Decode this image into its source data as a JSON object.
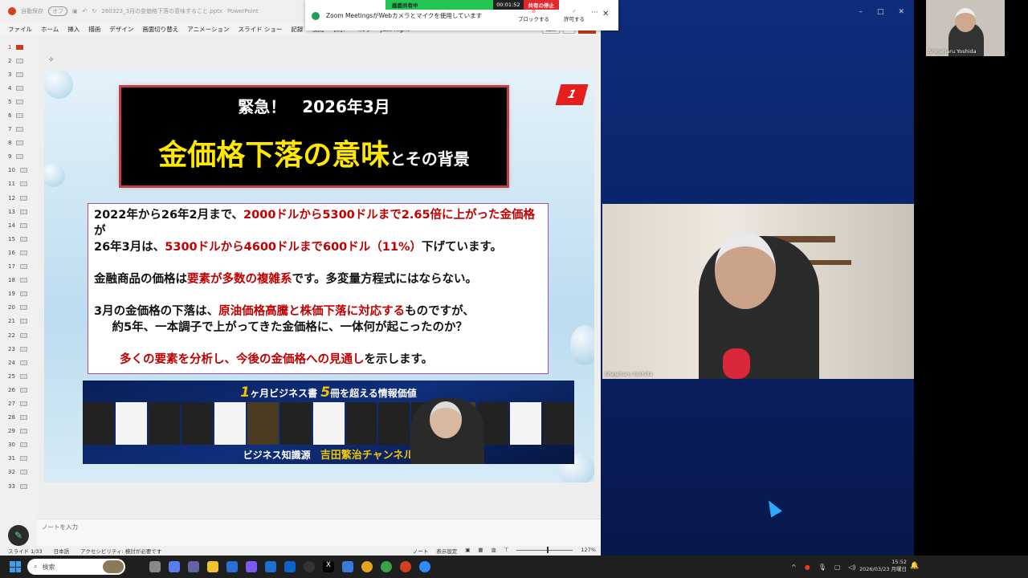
{
  "powerpoint": {
    "titlebar": {
      "autosave_label": "自動保存",
      "autosave_state": "オフ",
      "filename": "260323_3月の金価格下落の意味すること.pptx",
      "app": "PowerPoint"
    },
    "ribbon_tabs": [
      "ファイル",
      "ホーム",
      "挿入",
      "描画",
      "デザイン",
      "画面切り替え",
      "アニメーション",
      "スライド ショー",
      "記録",
      "校閲",
      "表示",
      "ヘルプ",
      "Just Right"
    ],
    "record_label": "記録",
    "share_label": "共有",
    "thumbnail_numbers": [
      "1",
      "2",
      "3",
      "4",
      "5",
      "6",
      "7",
      "8",
      "9",
      "10",
      "11",
      "12",
      "13",
      "14",
      "15",
      "16",
      "17",
      "18",
      "19",
      "20",
      "21",
      "22",
      "23",
      "24",
      "25",
      "26",
      "27",
      "28",
      "29",
      "30",
      "31",
      "32",
      "33"
    ],
    "slide": {
      "title_line1": "緊急！　2026年3月",
      "title_main": "金価格下落の意味",
      "title_suffix": "とその背景",
      "number_badge": "1",
      "para1": [
        {
          "t": "2022年から26年2月まで、",
          "red": false
        },
        {
          "t": "2000ドルから5300ドルまで2.65倍に上がった金価格",
          "red": true
        },
        {
          "t": "が",
          "red": false
        }
      ],
      "para1b": [
        {
          "t": "26年3月は、",
          "red": false
        },
        {
          "t": "5300ドルから4600ドルまで600ドル（11%）",
          "red": true
        },
        {
          "t": "下げています。",
          "red": false
        }
      ],
      "para2": [
        {
          "t": "金融商品の価格は",
          "red": false
        },
        {
          "t": "要素が多数の複雑系",
          "red": true
        },
        {
          "t": "です。多変量方程式にはならない。",
          "red": false
        }
      ],
      "para3": [
        {
          "t": "3月の金価格の下落は、",
          "red": false
        },
        {
          "t": "原油価格高騰と株価下落に対応する",
          "red": true
        },
        {
          "t": "ものですが、",
          "red": false
        }
      ],
      "para3b": "　約5年、一本調子で上がってきた金価格に、一体何が起こったのか？",
      "para4": [
        {
          "t": "多くの要素を分析し、今後の金価格への見通し",
          "red": true
        },
        {
          "t": "を示します。",
          "red": false
        }
      ],
      "banner_head_num1": "1",
      "banner_head_mid": "ヶ月ビジネス書",
      "banner_head_num2": "5",
      "banner_head_end": "冊を超える情報価値",
      "banner_foot_label": "ビジネス知識源",
      "banner_foot_name": "吉田繁治チャンネル"
    },
    "notes_placeholder": "ノートを入力",
    "status": {
      "slide": "スライド 1/33",
      "language": "日本語",
      "accessibility": "アクセシビリティ: 検討が必要です",
      "notes": "ノート",
      "display_settings": "表示設定",
      "zoom": "127%",
      "zoom_level": 0.55
    }
  },
  "zoom_notification": {
    "sharing_label": "画面共有中",
    "timer": "00:01:52",
    "stop_label": "共有の停止",
    "message": "Zoom MeetingsがWebカメラとマイクを使用しています",
    "block_label": "ブロックする",
    "allow_label": "許可する"
  },
  "zoom_window": {
    "participant_name": "Shigeharu Yoshida",
    "thumbnail_name": "Shigeharu Yoshida"
  },
  "taskbar": {
    "search_placeholder": "検索",
    "time": "15:52",
    "date": "2026/03/23 月曜日"
  },
  "colors": {
    "accent_red": "#c00000",
    "title_yellow": "#ffe800",
    "zoom_blue": "#0d2c7a",
    "share_green": "#23c552",
    "stop_red": "#e0282e"
  }
}
